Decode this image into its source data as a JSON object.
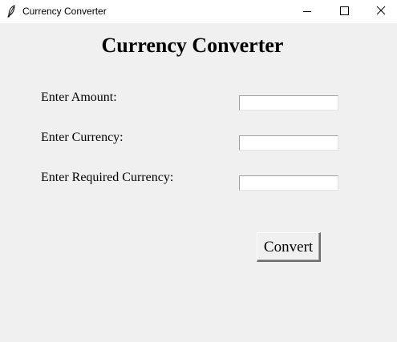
{
  "window": {
    "title": "Currency Converter",
    "icon": "feather-icon",
    "controls": [
      "minimize-icon",
      "maximize-icon",
      "close-icon"
    ]
  },
  "form": {
    "heading": "Currency Converter",
    "amount_label": "Enter Amount:",
    "amount_value": "",
    "currency_label": "Enter Currency:",
    "currency_value": "",
    "required_currency_label": "Enter Required Currency:",
    "required_currency_value": "",
    "convert_label": "Convert"
  },
  "colors": {
    "background": "#f0f0f0",
    "titlebar": "#ffffff",
    "text": "#000000"
  }
}
